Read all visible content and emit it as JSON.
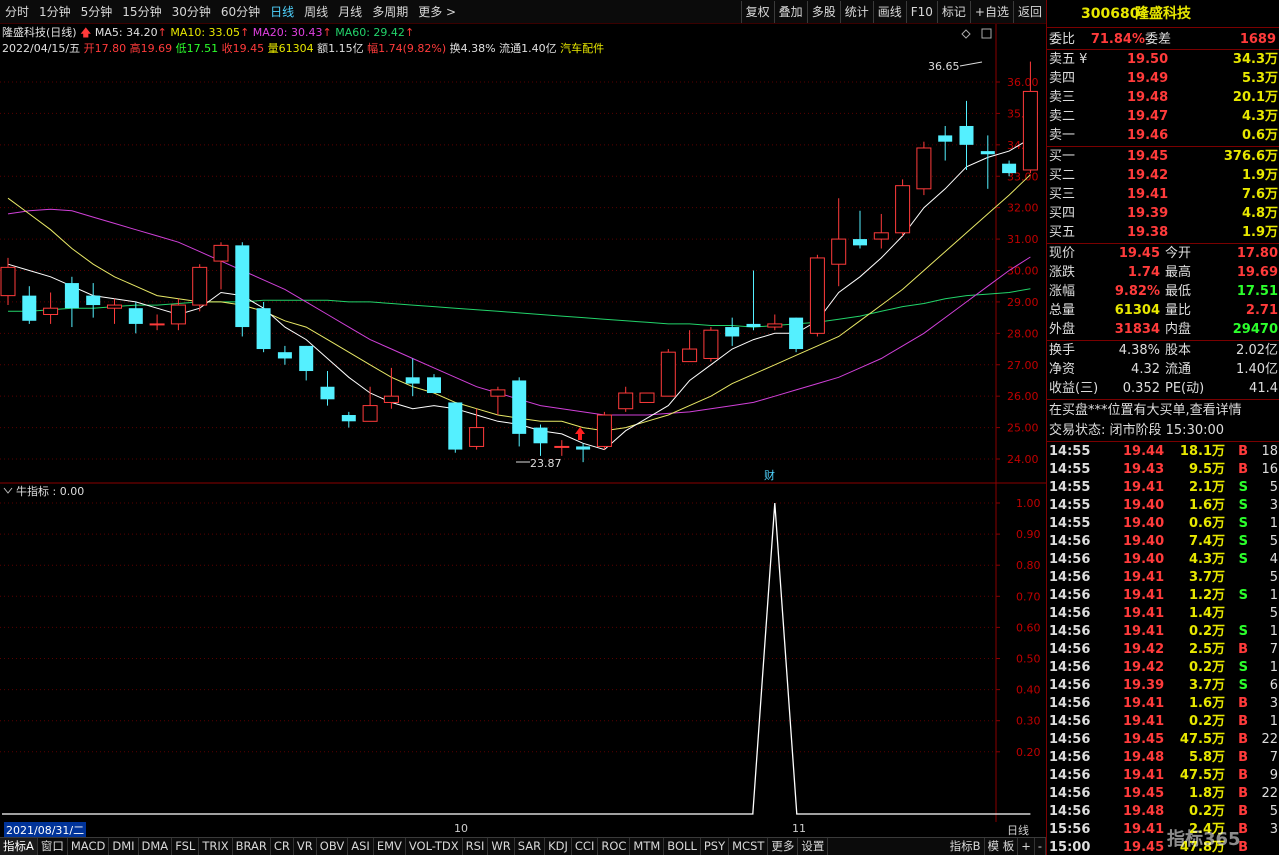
{
  "toolbar": {
    "tabs": [
      "分时",
      "1分钟",
      "5分钟",
      "15分钟",
      "30分钟",
      "60分钟",
      "日线",
      "周线",
      "月线",
      "多周期",
      "更多 >"
    ],
    "active_tab": 6,
    "right_buttons": [
      "复权",
      "叠加",
      "多股",
      "统计",
      "画线",
      "F10",
      "标记",
      "+自选",
      "返回"
    ]
  },
  "header": {
    "stock_name": "隆盛科技(日线)",
    "ma5": "MA5: 34.20",
    "ma10": "MA10: 33.05",
    "ma20": "MA20: 30.43",
    "ma60": "MA60: 29.42",
    "date": "2022/04/15/五",
    "open_label": "开",
    "open": "17.80",
    "high_label": "高",
    "high": "19.69",
    "low_label": "低",
    "low": "17.51",
    "close_label": "收",
    "close": "19.45",
    "vol_label": "量",
    "vol": "61304",
    "amount_label": "额",
    "amount": "1.15亿",
    "change_label": "幅",
    "change": "1.74(9.82%)",
    "turnover": "换4.38%",
    "float": "流通1.40亿",
    "sector": "汽车配件"
  },
  "chart": {
    "price_ticks": [
      "36.00",
      "35.00",
      "34.00",
      "33.00",
      "32.00",
      "31.00",
      "30.00",
      "29.00",
      "28.00",
      "27.00",
      "26.00",
      "25.00",
      "24.00"
    ],
    "high_marker": "36.65",
    "low_marker": "23.87",
    "finance_marker": "财",
    "colors": {
      "up": "#ff3b3b",
      "down": "#54f0ff",
      "ma5": "#ffffff",
      "ma10": "#e8e866",
      "ma20": "#d040d8",
      "ma60": "#22d36a"
    }
  },
  "indicator": {
    "title": "牛指标 : 0.00",
    "ticks": [
      "1.00",
      "0.90",
      "0.80",
      "0.70",
      "0.60",
      "0.50",
      "0.40",
      "0.30",
      "0.20"
    ]
  },
  "date_bar": {
    "start": "2021/08/31/二",
    "month1": "10",
    "month2": "11",
    "right_label": "日线"
  },
  "bottom_tabs": [
    "指标A",
    "窗口",
    "MACD",
    "DMI",
    "DMA",
    "FSL",
    "TRIX",
    "BRAR",
    "CR",
    "VR",
    "OBV",
    "ASI",
    "EMV",
    "VOL-TDX",
    "RSI",
    "WR",
    "SAR",
    "KDJ",
    "CCI",
    "ROC",
    "MTM",
    "BOLL",
    "PSY",
    "MCST",
    "更多",
    "设置",
    "指标B",
    "模 板",
    "+",
    "-"
  ],
  "panel": {
    "code": "300680",
    "name": "隆盛科技",
    "weibi_label": "委比",
    "weibi": "71.84%",
    "weicha_label": "委差",
    "weicha": "1689",
    "asks": [
      {
        "label": "卖五 ¥",
        "price": "19.50",
        "vol": "34.3万"
      },
      {
        "label": "卖四",
        "price": "19.49",
        "vol": "5.3万"
      },
      {
        "label": "卖三",
        "price": "19.48",
        "vol": "20.1万"
      },
      {
        "label": "卖二",
        "price": "19.47",
        "vol": "4.3万"
      },
      {
        "label": "卖一",
        "price": "19.46",
        "vol": "0.6万"
      }
    ],
    "bids": [
      {
        "label": "买一",
        "price": "19.45",
        "vol": "376.6万"
      },
      {
        "label": "买二",
        "price": "19.42",
        "vol": "1.9万"
      },
      {
        "label": "买三",
        "price": "19.41",
        "vol": "7.6万"
      },
      {
        "label": "买四",
        "price": "19.39",
        "vol": "4.8万"
      },
      {
        "label": "买五",
        "price": "19.38",
        "vol": "1.9万"
      }
    ],
    "stats": [
      {
        "l1": "现价",
        "v1": "19.45",
        "l2": "今开",
        "v2": "17.80",
        "c1": "red",
        "c2": "red"
      },
      {
        "l1": "涨跌",
        "v1": "1.74",
        "l2": "最高",
        "v2": "19.69",
        "c1": "red",
        "c2": "red"
      },
      {
        "l1": "涨幅",
        "v1": "9.82%",
        "l2": "最低",
        "v2": "17.51",
        "c1": "red",
        "c2": "lime"
      },
      {
        "l1": "总量",
        "v1": "61304",
        "l2": "量比",
        "v2": "2.71",
        "c1": "yellow",
        "c2": "red"
      },
      {
        "l1": "外盘",
        "v1": "31834",
        "l2": "内盘",
        "v2": "29470",
        "c1": "red",
        "c2": "lime"
      }
    ],
    "stats2": [
      {
        "l1": "换手",
        "v1": "4.38%",
        "l2": "股本",
        "v2": "2.02亿"
      },
      {
        "l1": "净资",
        "v1": "4.32",
        "l2": "流通",
        "v2": "1.40亿"
      },
      {
        "l1": "收益(三)",
        "v1": "0.352",
        "l2": "PE(动)",
        "v2": "41.4"
      }
    ],
    "notice": "在买盘***位置有大买单,查看详情",
    "status": "交易状态: 闭市阶段 15:30:00",
    "ticks": [
      {
        "t": "14:55",
        "p": "19.44",
        "v": "18.1万",
        "s": "B",
        "n": "18"
      },
      {
        "t": "14:55",
        "p": "19.43",
        "v": "9.5万",
        "s": "B",
        "n": "16"
      },
      {
        "t": "14:55",
        "p": "19.41",
        "v": "2.1万",
        "s": "S",
        "n": "5"
      },
      {
        "t": "14:55",
        "p": "19.40",
        "v": "1.6万",
        "s": "S",
        "n": "3"
      },
      {
        "t": "14:55",
        "p": "19.40",
        "v": "0.6万",
        "s": "S",
        "n": "1"
      },
      {
        "t": "14:56",
        "p": "19.40",
        "v": "7.4万",
        "s": "S",
        "n": "5"
      },
      {
        "t": "14:56",
        "p": "19.40",
        "v": "4.3万",
        "s": "S",
        "n": "4"
      },
      {
        "t": "14:56",
        "p": "19.41",
        "v": "3.7万",
        "s": "",
        "n": "5"
      },
      {
        "t": "14:56",
        "p": "19.41",
        "v": "1.2万",
        "s": "S",
        "n": "1"
      },
      {
        "t": "14:56",
        "p": "19.41",
        "v": "1.4万",
        "s": "",
        "n": "5"
      },
      {
        "t": "14:56",
        "p": "19.41",
        "v": "0.2万",
        "s": "S",
        "n": "1"
      },
      {
        "t": "14:56",
        "p": "19.42",
        "v": "2.5万",
        "s": "B",
        "n": "7"
      },
      {
        "t": "14:56",
        "p": "19.42",
        "v": "0.2万",
        "s": "S",
        "n": "1"
      },
      {
        "t": "14:56",
        "p": "19.39",
        "v": "3.7万",
        "s": "S",
        "n": "6"
      },
      {
        "t": "14:56",
        "p": "19.41",
        "v": "1.6万",
        "s": "B",
        "n": "3"
      },
      {
        "t": "14:56",
        "p": "19.41",
        "v": "0.2万",
        "s": "B",
        "n": "1"
      },
      {
        "t": "14:56",
        "p": "19.45",
        "v": "47.5万",
        "s": "B",
        "n": "22"
      },
      {
        "t": "14:56",
        "p": "19.48",
        "v": "5.8万",
        "s": "B",
        "n": "7"
      },
      {
        "t": "14:56",
        "p": "19.41",
        "v": "47.5万",
        "s": "B",
        "n": "9"
      },
      {
        "t": "14:56",
        "p": "19.45",
        "v": "1.8万",
        "s": "B",
        "n": "22"
      },
      {
        "t": "14:56",
        "p": "19.48",
        "v": "0.2万",
        "s": "B",
        "n": "5"
      },
      {
        "t": "15:56",
        "p": "19.41",
        "v": "2.4万",
        "s": "B",
        "n": "3"
      },
      {
        "t": "15:00",
        "p": "19.45",
        "v": "47.8万",
        "s": "B",
        "n": ""
      }
    ],
    "watermark": "指标365"
  },
  "chart_data": {
    "type": "candlestick",
    "candles": [
      [
        29.2,
        30.1,
        28.9,
        30.4
      ],
      [
        29.2,
        28.4,
        28.3,
        29.5
      ],
      [
        28.6,
        28.8,
        28.3,
        29.3
      ],
      [
        29.6,
        28.8,
        28.2,
        29.8
      ],
      [
        29.2,
        28.9,
        28.5,
        29.6
      ],
      [
        28.8,
        28.9,
        28.3,
        29.1
      ],
      [
        28.8,
        28.3,
        28.0,
        29.0
      ],
      [
        28.3,
        28.3,
        28.1,
        28.6
      ],
      [
        28.3,
        28.9,
        28.1,
        29.1
      ],
      [
        28.9,
        30.1,
        28.7,
        30.2
      ],
      [
        30.3,
        30.8,
        29.4,
        30.9
      ],
      [
        30.8,
        28.2,
        27.9,
        30.9
      ],
      [
        28.8,
        27.5,
        27.4,
        29.0
      ],
      [
        27.4,
        27.2,
        27.0,
        27.6
      ],
      [
        27.6,
        26.8,
        26.5,
        27.6
      ],
      [
        26.3,
        25.9,
        25.7,
        26.8
      ],
      [
        25.4,
        25.2,
        25.0,
        25.5
      ],
      [
        25.2,
        25.7,
        25.2,
        26.3
      ],
      [
        25.8,
        26.0,
        25.6,
        26.9
      ],
      [
        26.6,
        26.4,
        26.0,
        27.2
      ],
      [
        26.6,
        26.1,
        26.1,
        26.7
      ],
      [
        25.8,
        24.3,
        24.2,
        25.8
      ],
      [
        24.4,
        25.0,
        24.3,
        25.6
      ],
      [
        26.0,
        26.2,
        25.4,
        26.3
      ],
      [
        26.5,
        24.8,
        24.4,
        26.6
      ],
      [
        25.0,
        24.5,
        24.1,
        25.1
      ],
      [
        24.4,
        24.4,
        24.1,
        24.6
      ],
      [
        24.4,
        24.3,
        23.9,
        24.5
      ],
      [
        24.4,
        25.4,
        24.3,
        25.5
      ],
      [
        25.6,
        26.1,
        25.5,
        26.3
      ],
      [
        25.8,
        26.1,
        25.8,
        26.1
      ],
      [
        26.0,
        27.4,
        26.0,
        27.5
      ],
      [
        27.1,
        27.5,
        27.1,
        28.1
      ],
      [
        27.2,
        28.1,
        27.1,
        28.2
      ],
      [
        28.2,
        27.9,
        27.6,
        28.5
      ],
      [
        28.3,
        28.2,
        28.1,
        30.0
      ],
      [
        28.2,
        28.3,
        28.1,
        28.6
      ],
      [
        28.5,
        27.5,
        27.4,
        28.5
      ],
      [
        28.0,
        30.4,
        27.9,
        30.5
      ],
      [
        30.2,
        31.0,
        29.5,
        32.3
      ],
      [
        31.0,
        30.8,
        30.7,
        31.9
      ],
      [
        31.0,
        31.2,
        30.7,
        31.8
      ],
      [
        31.2,
        32.7,
        31.1,
        32.9
      ],
      [
        32.6,
        33.9,
        32.4,
        34.1
      ],
      [
        34.3,
        34.1,
        33.5,
        34.6
      ],
      [
        34.6,
        34.0,
        33.2,
        35.4
      ],
      [
        33.8,
        33.7,
        32.6,
        34.3
      ],
      [
        33.4,
        33.1,
        33.0,
        33.5
      ],
      [
        33.2,
        35.7,
        33.1,
        36.65
      ]
    ],
    "ma_x_start": 0,
    "ma5": [
      30.2,
      30.0,
      29.8,
      29.5,
      29.2,
      29.1,
      29.0,
      28.8,
      28.6,
      28.8,
      29.3,
      29.2,
      28.8,
      28.2,
      27.8,
      27.2,
      26.6,
      26.1,
      25.8,
      25.6,
      25.7,
      25.6,
      25.4,
      25.2,
      25.1,
      24.9,
      24.8,
      24.5,
      24.3,
      24.9,
      25.3,
      25.7,
      26.5,
      27.0,
      27.5,
      27.8,
      28.0,
      28.0,
      28.4,
      29.3,
      29.8,
      30.4,
      31.1,
      32.0,
      32.6,
      33.3,
      33.6,
      33.8,
      34.2
    ],
    "ma10": [
      32.3,
      31.8,
      31.3,
      30.7,
      30.2,
      29.8,
      29.5,
      29.2,
      29.1,
      29.0,
      29.0,
      28.9,
      28.7,
      28.4,
      28.2,
      27.8,
      27.4,
      27.0,
      26.6,
      26.3,
      26.1,
      25.8,
      25.6,
      25.4,
      25.3,
      25.2,
      25.2,
      25.0,
      24.9,
      25.0,
      25.2,
      25.4,
      25.7,
      26.0,
      26.4,
      26.7,
      27.0,
      27.3,
      27.6,
      27.9,
      28.4,
      28.9,
      29.4,
      30.0,
      30.6,
      31.2,
      31.8,
      32.4,
      33.05
    ],
    "ma20": [
      31.8,
      31.9,
      31.95,
      31.9,
      31.7,
      31.5,
      31.3,
      31.1,
      30.9,
      30.6,
      30.3,
      30.0,
      29.7,
      29.4,
      29.0,
      28.6,
      28.2,
      27.8,
      27.5,
      27.2,
      26.9,
      26.6,
      26.3,
      26.1,
      25.9,
      25.7,
      25.6,
      25.5,
      25.4,
      25.4,
      25.4,
      25.45,
      25.5,
      25.6,
      25.7,
      25.8,
      26.0,
      26.2,
      26.4,
      26.6,
      26.9,
      27.2,
      27.6,
      28.0,
      28.5,
      29.0,
      29.5,
      30.0,
      30.43
    ],
    "ma60": [
      28.7,
      28.7,
      28.75,
      28.8,
      28.8,
      28.85,
      28.9,
      28.9,
      28.95,
      29.0,
      29.0,
      29.0,
      29.05,
      29.05,
      29.05,
      29.05,
      29.0,
      29.0,
      28.95,
      28.9,
      28.85,
      28.8,
      28.75,
      28.7,
      28.65,
      28.6,
      28.55,
      28.5,
      28.45,
      28.4,
      28.35,
      28.3,
      28.3,
      28.25,
      28.25,
      28.2,
      28.25,
      28.3,
      28.35,
      28.45,
      28.55,
      28.7,
      28.85,
      28.95,
      29.1,
      29.2,
      29.25,
      29.3,
      29.42
    ],
    "indicator_series": [
      0,
      0,
      0,
      0,
      0,
      0,
      0,
      0,
      0,
      0,
      0,
      0,
      0,
      0,
      0,
      0,
      0,
      0,
      0,
      0,
      0,
      0,
      0,
      0,
      0,
      0,
      0,
      0,
      0,
      0,
      0,
      0,
      0,
      0,
      0,
      0,
      1,
      0,
      0,
      0,
      0,
      0,
      0,
      0,
      0,
      0,
      0,
      0,
      0
    ],
    "ylim": [
      23.5,
      37.0
    ]
  }
}
